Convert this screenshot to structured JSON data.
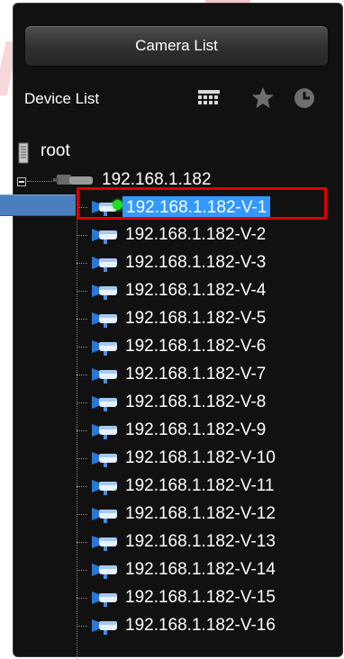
{
  "panel": {
    "camera_list_button": "Camera List",
    "device_list_label": "Device List",
    "icons": [
      "grid-layout-icon",
      "star-icon",
      "clock-icon"
    ]
  },
  "tree": {
    "root_label": "root",
    "device_ip": "192.168.1.182",
    "channels": [
      {
        "label": "192.168.1.182-V-1",
        "selected": true,
        "live": true
      },
      {
        "label": "192.168.1.182-V-2"
      },
      {
        "label": "192.168.1.182-V-3"
      },
      {
        "label": "192.168.1.182-V-4"
      },
      {
        "label": "192.168.1.182-V-5"
      },
      {
        "label": "192.168.1.182-V-6"
      },
      {
        "label": "192.168.1.182-V-7"
      },
      {
        "label": "192.168.1.182-V-8"
      },
      {
        "label": "192.168.1.182-V-9"
      },
      {
        "label": "192.168.1.182-V-10"
      },
      {
        "label": "192.168.1.182-V-11"
      },
      {
        "label": "192.168.1.182-V-12"
      },
      {
        "label": "192.168.1.182-V-13"
      },
      {
        "label": "192.168.1.182-V-14"
      },
      {
        "label": "192.168.1.182-V-15"
      },
      {
        "label": "192.168.1.182-V-16"
      }
    ]
  },
  "colors": {
    "panel_bg": "#111111",
    "selection": "#3399ff",
    "live_indicator": "#22dd22",
    "annotation_box": "#e00000",
    "annotation_arrow": "#4a7fbf"
  }
}
